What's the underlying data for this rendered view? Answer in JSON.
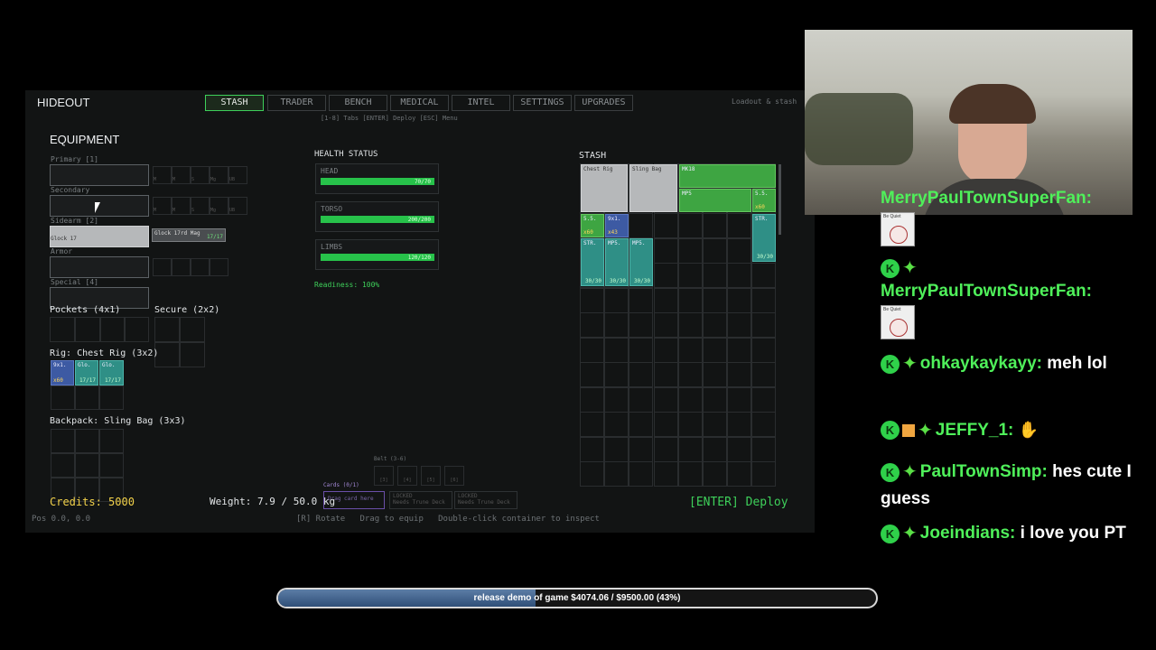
{
  "hideout": {
    "title": "HIDEOUT",
    "tabs": [
      "STASH",
      "TRADER",
      "BENCH",
      "MEDICAL",
      "INTEL",
      "SETTINGS",
      "UPGRADES"
    ],
    "active_tab": "STASH",
    "hint": "[1-8] Tabs [ENTER] Deploy [ESC] Menu",
    "top_right": "Loadout & stash",
    "equipment_heading": "EQUIPMENT",
    "slots": {
      "primary": "Primary [1]",
      "secondary": "Secondary",
      "sidearm": "Sidearm [2]",
      "sidearm_item": "Glock 17",
      "sidearm_mag": "Glock 17rd Mag",
      "sidearm_mag_count": "17/17",
      "armor": "Armor",
      "special": "Special [4]",
      "attach_labels": [
        "M",
        "M",
        "S",
        "Mg",
        "UB"
      ]
    },
    "pockets": "Pockets (4x1)",
    "secure": "Secure (2x2)",
    "rig": "Rig: Chest Rig (3x2)",
    "rig_items": [
      {
        "name": "9x1.",
        "count": "x60"
      },
      {
        "name": "Glo.",
        "count": "17/17"
      },
      {
        "name": "Glo.",
        "count": "17/17"
      }
    ],
    "backpack": "Backpack: Sling Bag (3x3)",
    "health_heading": "HEALTH STATUS",
    "health": [
      {
        "part": "HEAD",
        "value": "70/70",
        "pct": 1.0
      },
      {
        "part": "TORSO",
        "value": "200/200",
        "pct": 1.0
      },
      {
        "part": "LIMBS",
        "value": "120/120",
        "pct": 1.0
      }
    ],
    "readiness": "Readiness: 100%",
    "belt_label": "Belt (3-6)",
    "belt_slots": [
      "[3]",
      "[4]",
      "[5]",
      "[6]"
    ],
    "cards_label": "Cards (0/1)",
    "card_drop": "Drag card here",
    "locked_label": "LOCKED",
    "locked_hint": "Needs Trune Deck",
    "credits": "Credits: 5000",
    "weight": "Weight: 7.9 / 50.0 kg",
    "controls": "[R] Rotate   Drag to equip   Double-click container to inspect",
    "pos": "Pos 0.0, 0.0",
    "deploy": "[ENTER] Deploy",
    "stash_heading": "STASH",
    "stash_items": {
      "chest_rig": "Chest Rig",
      "sling_bag": "Sling Bag",
      "mk": "MK18",
      "mps_top": "MP5",
      "ss_right": "5.5.",
      "ss_right_qty": "x60",
      "ss_left": "5.5.",
      "ss_left_qty": "x60",
      "nine": "9x1.",
      "nine_qty": "x43",
      "str_right": "STR.",
      "str_right_val": "30/30",
      "str1": "STR.",
      "mps1": "MP5.",
      "mps2": "MP5.",
      "str_vals": [
        "30/30",
        "30/30",
        "30/30"
      ]
    }
  },
  "chat": {
    "messages": [
      {
        "user": "MerryPaulTownSuperFan:",
        "text": ""
      },
      {
        "user": "MerryPaulTownSuperFan:",
        "text": ""
      },
      {
        "user": "ohkaykaykayy:",
        "text": "meh lol"
      },
      {
        "user": "JEFFY_1:",
        "text": ""
      },
      {
        "user": "PaulTownSimp:",
        "text": "hes cute I guess"
      },
      {
        "user": "Joeindians:",
        "text": "i love you PT"
      }
    ],
    "emote_text": "Be Quiet"
  },
  "goal": {
    "text": "release demo of game $4074.06 / $9500.00 (43%)",
    "progress": 0.43
  },
  "colors": {
    "accent": "#3ed05a",
    "teal": "#2f8f86",
    "blue": "#3d5aa3"
  }
}
